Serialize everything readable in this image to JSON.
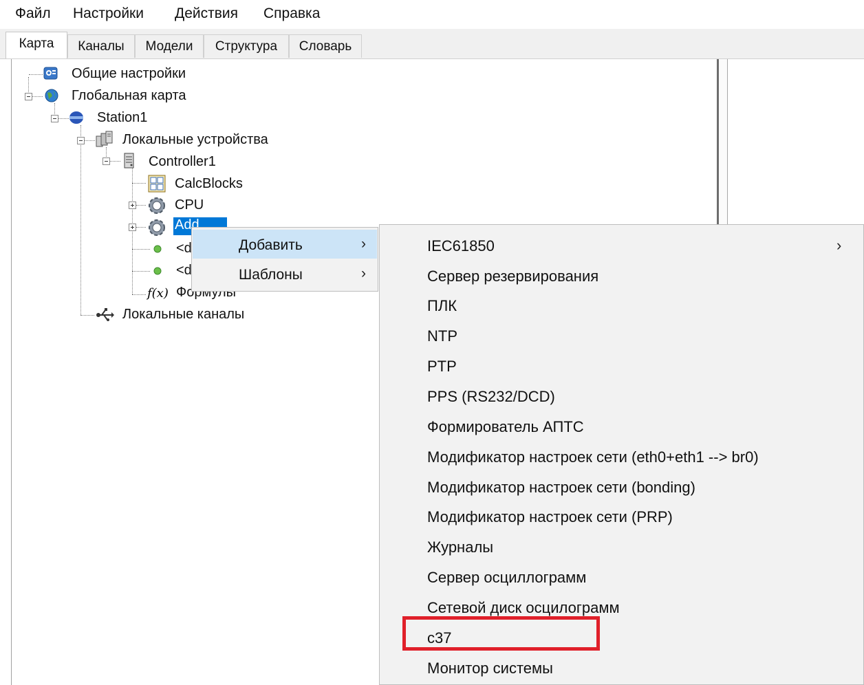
{
  "menu": {
    "items": [
      "Файл",
      "Настройки",
      "Действия",
      "Справка"
    ]
  },
  "tabs": [
    "Карта",
    "Каналы",
    "Модели",
    "Структура",
    "Словарь"
  ],
  "tree": {
    "general_settings": "Общие настройки",
    "global_map": "Глобальная карта",
    "station": "Station1",
    "local_devices": "Локальные устройства",
    "controller": "Controller1",
    "calcblocks": "CalcBlocks",
    "cpu": "CPU",
    "add_node": "Add",
    "d1": "<d",
    "d2": "<d",
    "formulas": "Формулы",
    "local_channels": "Локальные каналы"
  },
  "context_menu": {
    "items": [
      {
        "label": "Добавить",
        "has_submenu": true,
        "highlighted": true
      },
      {
        "label": "Шаблоны",
        "has_submenu": true,
        "highlighted": false
      }
    ]
  },
  "submenu": {
    "items": [
      {
        "label": "IEC61850",
        "has_submenu": true
      },
      {
        "label": "Сервер резервирования"
      },
      {
        "label": "ПЛК"
      },
      {
        "label": "NTP"
      },
      {
        "label": "PTP"
      },
      {
        "label": "PPS (RS232/DCD)"
      },
      {
        "label": "Формирователь АПТС"
      },
      {
        "label": "Модификатор настроек сети (eth0+eth1 --> br0)"
      },
      {
        "label": "Модификатор настроек сети (bonding)"
      },
      {
        "label": "Модификатор настроек сети (PRP)"
      },
      {
        "label": "Журналы"
      },
      {
        "label": "Сервер осциллограмм"
      },
      {
        "label": "Сетевой диск осцилограмм"
      },
      {
        "label": "c37",
        "annotated": true
      },
      {
        "label": "Монитор системы"
      }
    ],
    "submenu_arrow": "›"
  },
  "colors": {
    "selection": "#0078d7",
    "menu_highlight": "#cce4f7",
    "annotation": "#e0202a"
  }
}
